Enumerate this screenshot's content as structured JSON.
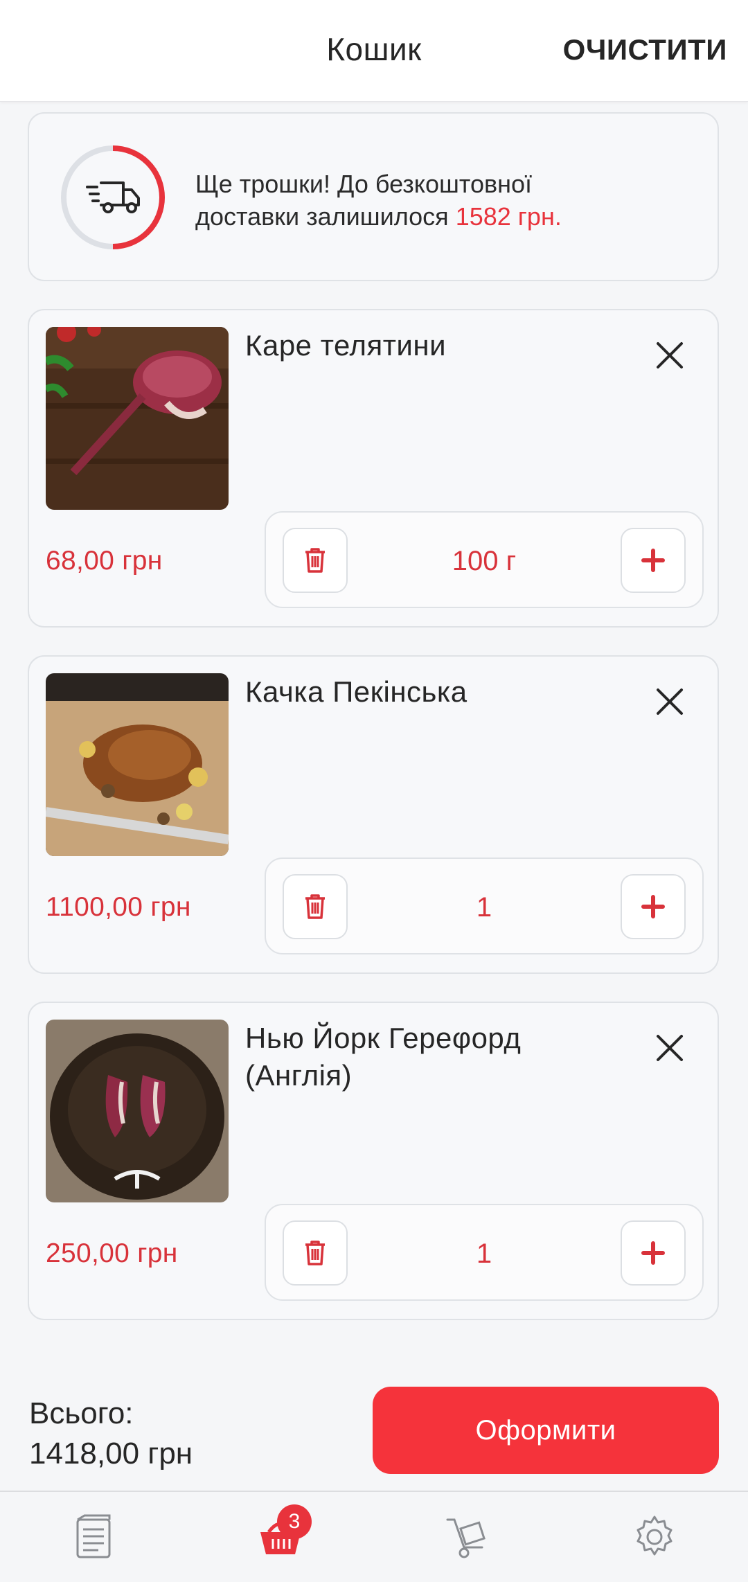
{
  "header": {
    "title": "Кошик",
    "clear_label": "ОЧИСТИТИ"
  },
  "delivery": {
    "message_line1": "Ще трошки! До безкоштовної",
    "message_line2": "доставки залишилося",
    "amount_left": "1582 грн.",
    "progress_fraction": 0.5
  },
  "items": [
    {
      "name": "Каре телятини",
      "price": "68,00 грн",
      "quantity": "100 г"
    },
    {
      "name": "Качка Пекінська",
      "price": "1100,00 грн",
      "quantity": "1"
    },
    {
      "name": "Нью Йорк Гереφорд (Англія)",
      "price": "250,00 грн",
      "quantity": "1"
    }
  ],
  "summary": {
    "total_label": "Всього:",
    "total_value": "1418,00 грн",
    "checkout_label": "Оформити"
  },
  "nav": {
    "cart_badge": "3",
    "items": [
      "catalog-icon",
      "cart-icon",
      "delivery-icon",
      "settings-icon"
    ]
  },
  "colors": {
    "accent": "#e8333c",
    "button": "#f5333b"
  }
}
